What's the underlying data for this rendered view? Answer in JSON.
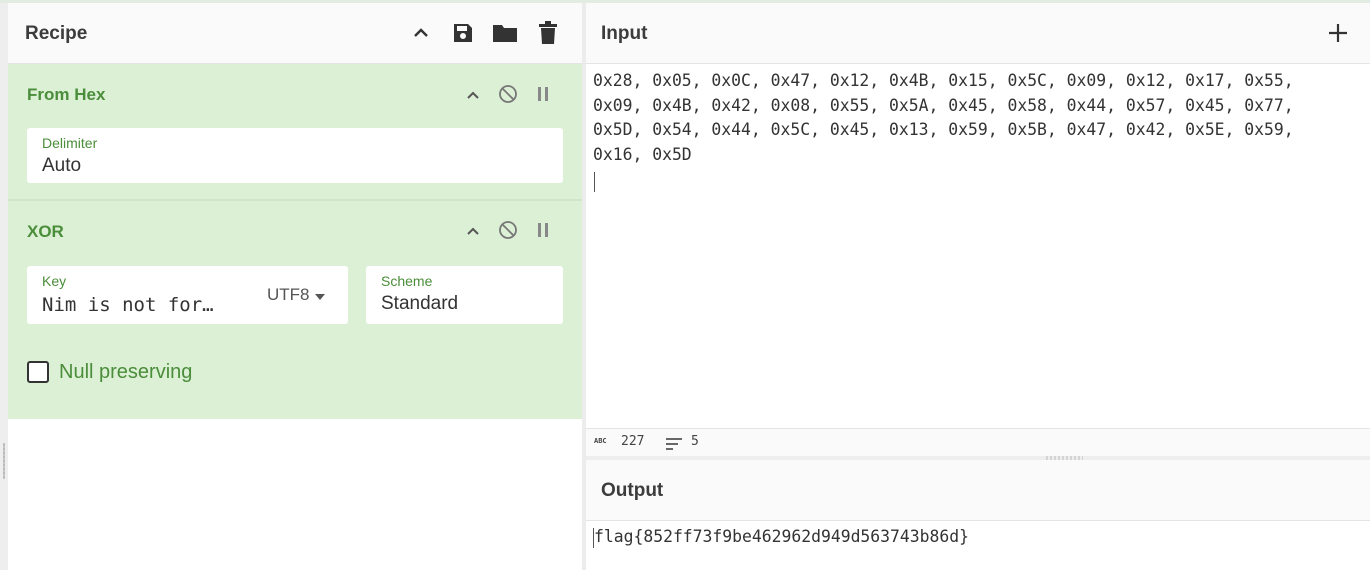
{
  "recipe": {
    "title": "Recipe",
    "icons": [
      "chevron-up-icon",
      "save-icon",
      "folder-icon",
      "trash-icon"
    ],
    "operations": [
      {
        "name": "From Hex",
        "fields": [
          {
            "label": "Delimiter",
            "value": "Auto"
          }
        ]
      },
      {
        "name": "XOR",
        "fields": [
          {
            "label": "Key",
            "value": "Nim is not for…",
            "encoding": "UTF8"
          },
          {
            "label": "Scheme",
            "value": "Standard"
          }
        ],
        "checkbox": {
          "label": "Null preserving",
          "checked": false
        }
      }
    ]
  },
  "input": {
    "title": "Input",
    "add_icon": "plus-icon",
    "lines": [
      "0x28, 0x05, 0x0C, 0x47, 0x12, 0x4B, 0x15, 0x5C, 0x09, 0x12, 0x17, 0x55,",
      "0x09, 0x4B, 0x42, 0x08, 0x55, 0x5A, 0x45, 0x58, 0x44, 0x57, 0x45, 0x77,",
      "0x5D, 0x54, 0x44, 0x5C, 0x45, 0x13, 0x59, 0x5B, 0x47, 0x42, 0x5E, 0x59,",
      "0x16, 0x5D"
    ],
    "status": {
      "abc_label": "ABC",
      "length": "227",
      "lines": "5"
    }
  },
  "output": {
    "title": "Output",
    "text": "flag{852ff73f9be462962d949d563743b86d}"
  },
  "colors": {
    "accent_green": "#4a8d3a",
    "op_background": "#dcf0d5"
  }
}
